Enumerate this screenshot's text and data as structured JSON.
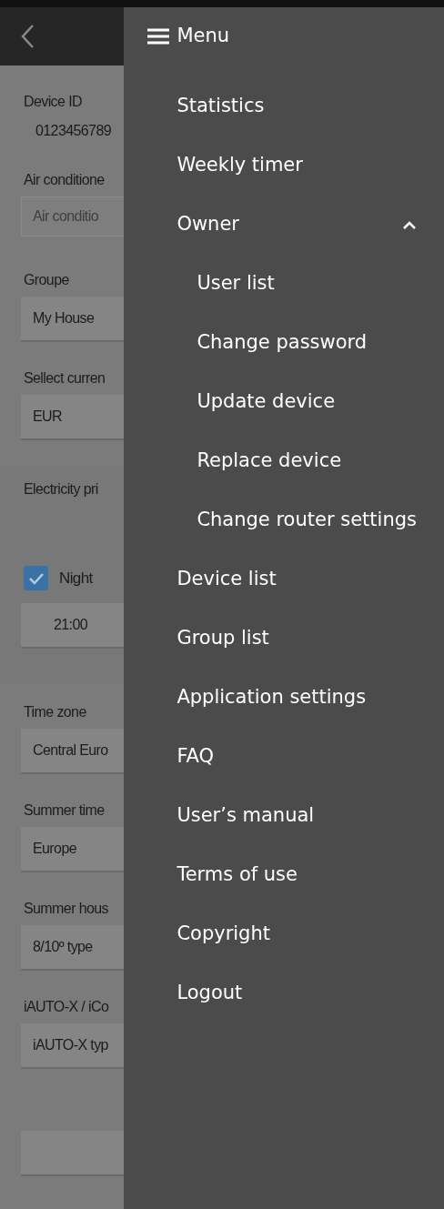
{
  "page": {
    "fields": [
      {
        "kind": "text",
        "label": "Device ID",
        "value": "0123456789"
      },
      {
        "kind": "input",
        "label": "Air conditione",
        "placeholder": "Air conditio"
      },
      {
        "kind": "select",
        "label": "Groupe",
        "value": "My House"
      },
      {
        "kind": "select",
        "label": "Sellect curren",
        "value": "EUR"
      },
      {
        "kind": "band",
        "label": "Electricity pri",
        "checkbox": {
          "label": "Night",
          "checked": true
        },
        "time": "21:00"
      },
      {
        "kind": "select",
        "label": "Time zone",
        "value": "Central Euro"
      },
      {
        "kind": "select",
        "label": "Summer time",
        "value": "Europe"
      },
      {
        "kind": "select",
        "label": "Summer hous",
        "value": "8/10º type"
      },
      {
        "kind": "select",
        "label": "iAUTO-X / iCo",
        "value": "iAUTO-X typ"
      },
      {
        "kind": "empty"
      }
    ]
  },
  "menu": {
    "title": "Menu",
    "items": [
      {
        "label": "Statistics"
      },
      {
        "label": "Weekly timer"
      },
      {
        "label": "Owner",
        "expanded": true,
        "children": [
          {
            "label": "User list"
          },
          {
            "label": "Change password"
          },
          {
            "label": "Update device"
          },
          {
            "label": "Replace device"
          },
          {
            "label": "Change router settings"
          }
        ]
      },
      {
        "label": "Device list"
      },
      {
        "label": "Group list"
      },
      {
        "label": "Application settings"
      },
      {
        "label": "FAQ"
      },
      {
        "label": "User’s manual"
      },
      {
        "label": "Terms of use"
      },
      {
        "label": "Copyright"
      },
      {
        "label": "Logout"
      }
    ]
  }
}
